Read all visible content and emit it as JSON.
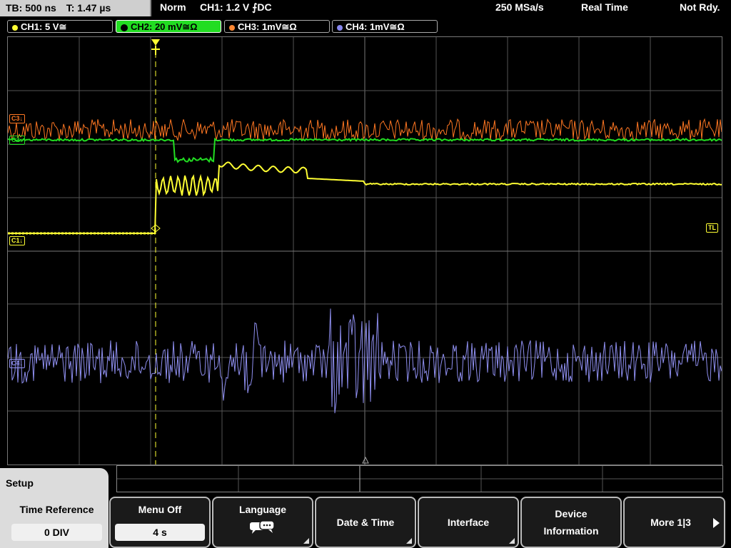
{
  "topbar": {
    "timebase": "TB: 500 ns",
    "trigger_time": "T: 1.47 µs",
    "mode": "Norm",
    "trigger_info": "CH1: 1.2 V ⨍DC",
    "sample_rate": "250 MSa/s",
    "acq_mode": "Real Time",
    "status": "Not Rdy."
  },
  "channels": [
    {
      "label": "CH1: 5 V≅",
      "color": "#ffff33",
      "active": false
    },
    {
      "label": "CH2: 20 mV≅Ω",
      "color": "#22dd22",
      "active": true
    },
    {
      "label": "CH3: 1mV≅Ω",
      "color": "#ff8833",
      "active": false
    },
    {
      "label": "CH4: 1mV≅Ω",
      "color": "#8888ee",
      "active": false
    }
  ],
  "markers": {
    "ch3": "C3↓",
    "ch2": "C2↓",
    "ch1": "C1↓",
    "ch4": "C4↓",
    "trigger_level": "TL"
  },
  "menu": {
    "title": "Setup",
    "softkeys": [
      {
        "label": "Time Reference",
        "value": "0 DIV"
      },
      {
        "label": "Menu Off",
        "value": "4 s"
      },
      {
        "label": "Language"
      },
      {
        "label": "Date & Time"
      },
      {
        "label": "Interface"
      },
      {
        "label": "Device Information"
      },
      {
        "label": "More 1|3"
      }
    ]
  },
  "icons": {
    "language": "speech-bubbles-icon",
    "more": "arrow-right-icon",
    "trigger": "trigger-t-icon"
  }
}
